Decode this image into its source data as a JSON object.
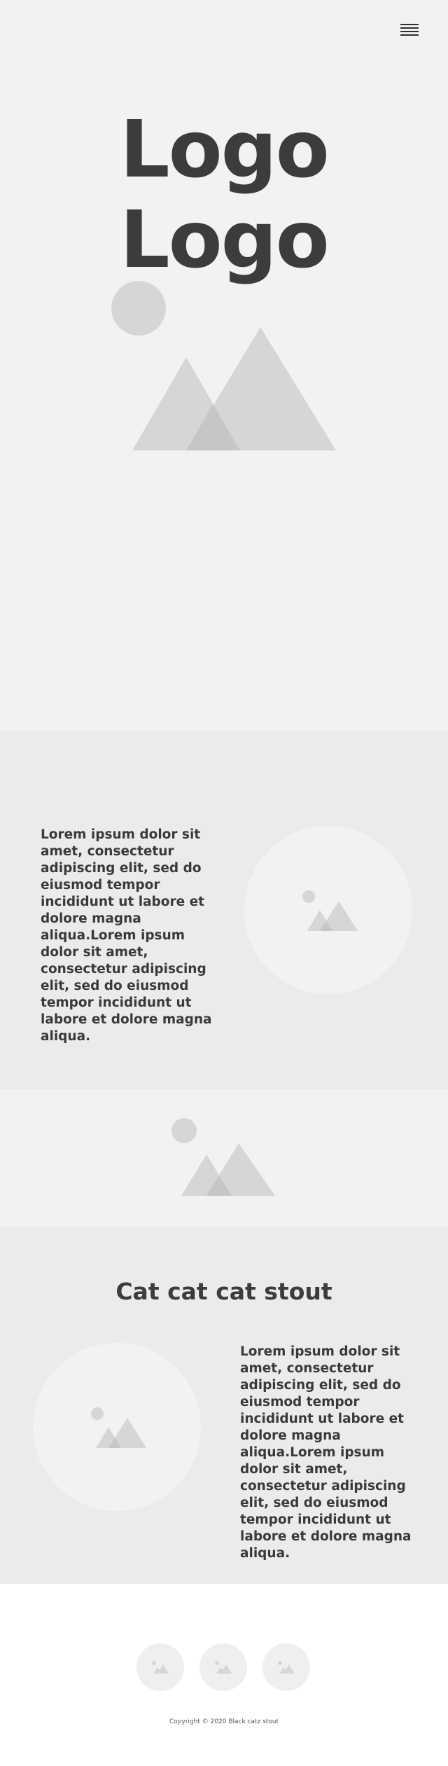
{
  "header": {
    "menu_icon": "hamburger-menu-icon",
    "logo_line1": "Logo",
    "logo_line2": "Logo",
    "hero_image_icon": "image-placeholder-icon"
  },
  "feature1": {
    "text": "Lorem ipsum dolor sit amet, consectetur adipiscing elit, sed do eiusmod tempor incididunt ut labore et dolore magna aliqua.Lorem ipsum dolor sit amet, consectetur adipiscing elit, sed do eiusmod tempor incididunt ut labore et dolore magna aliqua.",
    "image_icon": "image-placeholder-icon"
  },
  "banner": {
    "image_icon": "image-placeholder-icon"
  },
  "feature2": {
    "title": "Cat cat cat stout",
    "text": "Lorem ipsum dolor sit amet, consectetur adipiscing elit, sed do eiusmod tempor incididunt ut labore et dolore magna aliqua.Lorem ipsum dolor sit amet, consectetur adipiscing elit, sed do eiusmod tempor incididunt ut labore et dolore magna aliqua.",
    "image_icon": "image-placeholder-icon"
  },
  "footer": {
    "social_icons": [
      "image-placeholder-icon",
      "image-placeholder-icon",
      "image-placeholder-icon"
    ],
    "copyright": "Copyright © 2020 Black catz stout"
  },
  "colors": {
    "hero_bg": "#f2f2f2",
    "section_bg": "#ebebeb",
    "placeholder": "#d6d6d6",
    "text": "#3a3a3a"
  }
}
